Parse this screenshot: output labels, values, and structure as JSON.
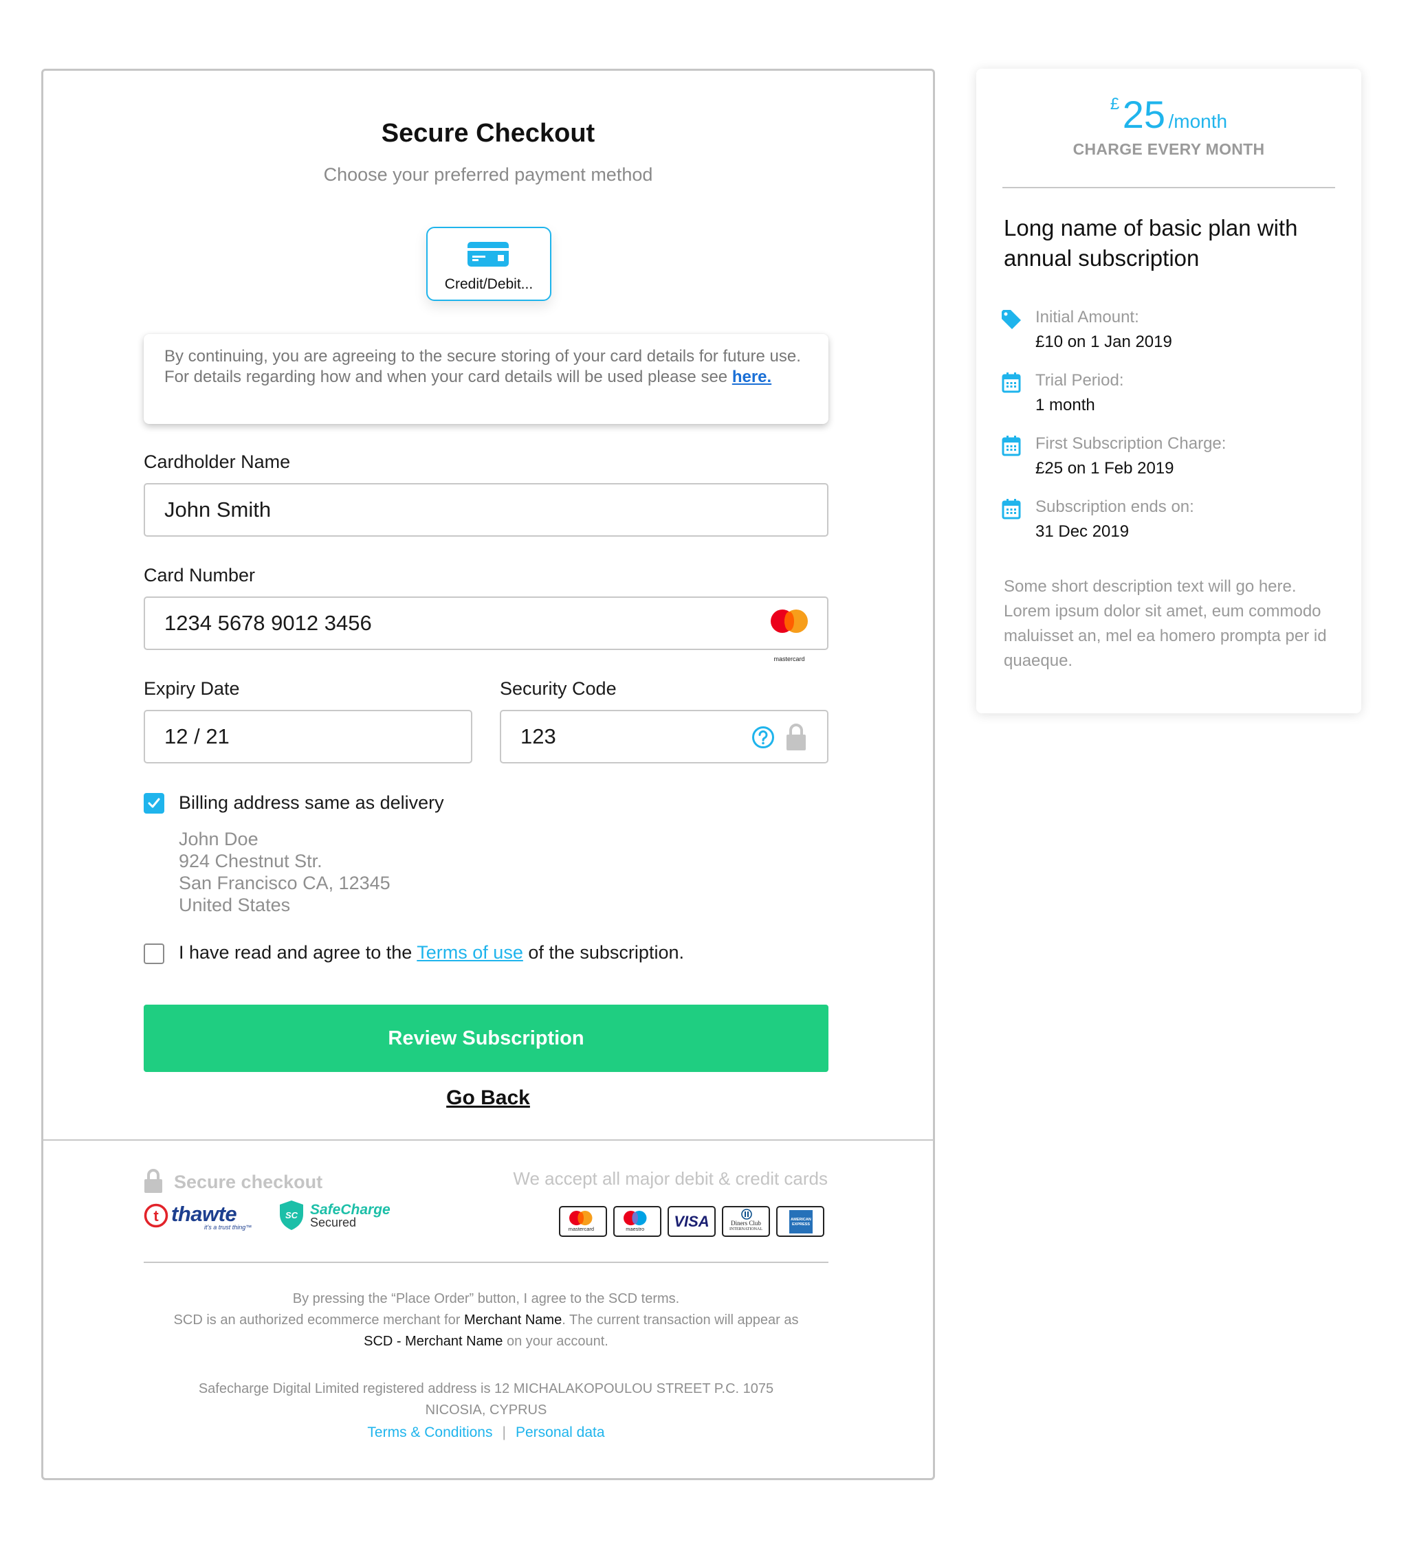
{
  "checkout": {
    "title": "Secure Checkout",
    "subtitle": "Choose your preferred payment method",
    "payment_methods": [
      {
        "label": "Credit/Debit...",
        "icon": "credit-card-icon",
        "selected": true
      }
    ],
    "notice": {
      "text": "By continuing, you are agreeing to the secure storing of your card details for future use. For details regarding how and when your card details will be used please see ",
      "link_label": "here."
    },
    "fields": {
      "cardholder": {
        "label": "Cardholder Name",
        "value": "John Smith"
      },
      "card_number": {
        "label": "Card Number",
        "value": "1234 5678 9012 3456",
        "brand": "mastercard"
      },
      "expiry": {
        "label": "Expiry Date",
        "value": "12 / 21"
      },
      "security_code": {
        "label": "Security Code",
        "value": "123"
      }
    },
    "billing": {
      "label": "Billing address same as delivery",
      "checked": true,
      "address": [
        "John Doe",
        "924 Chestnut Str.",
        "San Francisco CA, 12345",
        "United States"
      ]
    },
    "terms": {
      "checked": false,
      "before": "I have read and agree to the ",
      "link": "Terms of use",
      "after": " of the subscription."
    },
    "review_button": "Review Subscription",
    "go_back": "Go Back",
    "secure_label": "Secure checkout",
    "trust_logos": [
      "thawte",
      "SafeCharge Secured"
    ],
    "accept_label": "We accept all major debit & credit cards",
    "card_logos": [
      "mastercard",
      "maestro",
      "VISA",
      "Diners Club International",
      "American Express"
    ],
    "footer": {
      "line1": "By pressing the “Place Order” button, I agree to the SCD terms.",
      "line2_a": "SCD is an authorized ecommerce merchant for ",
      "line2_merchant": "Merchant Name",
      "line2_b": ". The current transaction will appear as",
      "line3_merchant": "SCD - Merchant Name",
      "line3_b": " on your account.",
      "address_1": "Safecharge Digital Limited registered address is 12 MICHALAKOPOULOU STREET P.C. 1075",
      "address_2": "NICOSIA, CYPRUS",
      "links": [
        "Terms & Conditions",
        "Personal data"
      ],
      "separator": "|"
    }
  },
  "summary": {
    "currency": "£",
    "amount": "25",
    "period": "/month",
    "charge_label": "CHARGE EVERY MONTH",
    "plan_name": "Long name of basic plan with annual subscription",
    "details": [
      {
        "icon": "tag-icon",
        "label": "Initial Amount:",
        "value": "£10 on 1 Jan 2019"
      },
      {
        "icon": "calendar-icon",
        "label": "Trial Period:",
        "value": "1 month"
      },
      {
        "icon": "calendar-icon",
        "label": "First Subscription Charge:",
        "value": "£25 on 1 Feb 2019"
      },
      {
        "icon": "calendar-icon",
        "label": "Subscription ends on:",
        "value": "31 Dec 2019"
      }
    ],
    "description": "Some short description text will go here. Lorem ipsum dolor sit amet, eum commodo maluisset an, mel ea homero prompta per id quaeque.",
    "accent_color": "#1fb4ec"
  },
  "colors": {
    "accent": "#1fb4ec",
    "primary_button": "#1fce81",
    "border": "#c8c8c8"
  }
}
